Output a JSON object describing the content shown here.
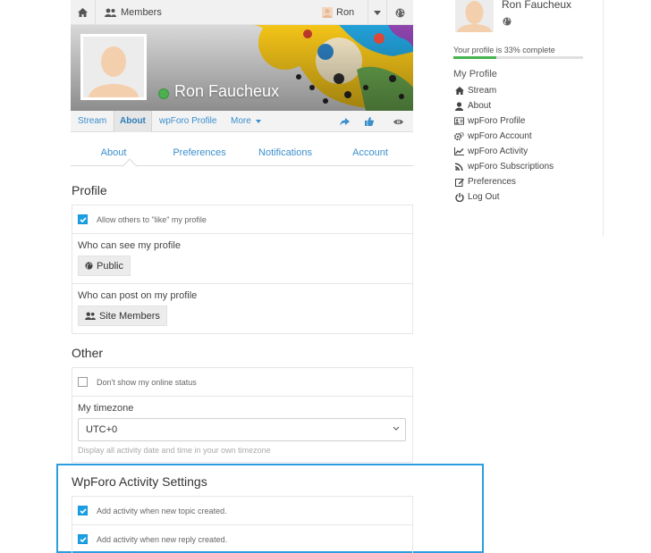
{
  "topbar": {
    "members_label": "Members",
    "user_label": "Ron"
  },
  "profile": {
    "display_name": "Ron Faucheux",
    "nav_tabs": [
      "Stream",
      "About",
      "wpForo Profile",
      "More"
    ]
  },
  "settings_tabs": [
    "About",
    "Preferences",
    "Notifications",
    "Account"
  ],
  "sections": {
    "profile_title": "Profile",
    "allow_like_label": "Allow others to \"like\" my profile",
    "who_see_label": "Who can see my profile",
    "who_see_value": "Public",
    "who_post_label": "Who can post on my profile",
    "who_post_value": "Site Members",
    "other_title": "Other",
    "online_status_label": "Don't show my online status",
    "timezone_label": "My timezone",
    "timezone_value": "UTC+0",
    "timezone_hint": "Display all activity date and time in your own timezone",
    "wpforo_title": "WpForo Activity Settings",
    "new_topic_label": "Add activity when new topic created.",
    "new_reply_label": "Add activity when new reply created."
  },
  "checkbox_states": {
    "allow_like": true,
    "online_status": false,
    "new_topic": true,
    "new_reply": true
  },
  "sidebar": {
    "name": "Ron Faucheux",
    "progress_text": "Your profile is 33% complete",
    "progress_value": 0.33,
    "menu_title": "My Profile",
    "items": [
      {
        "label": "Stream",
        "icon": "home-icon"
      },
      {
        "label": "About",
        "icon": "user-icon"
      },
      {
        "label": "wpForo Profile",
        "icon": "id-card-icon"
      },
      {
        "label": "wpForo Account",
        "icon": "cogs-icon"
      },
      {
        "label": "wpForo Activity",
        "icon": "line-chart-icon"
      },
      {
        "label": "wpForo Subscriptions",
        "icon": "rss-icon"
      },
      {
        "label": "Preferences",
        "icon": "edit-icon"
      },
      {
        "label": "Log Out",
        "icon": "power-icon"
      }
    ]
  },
  "colors": {
    "accent": "#3a8fcc",
    "checkbox": "#1aa0e6",
    "highlight_border": "#2b9de0",
    "online": "#4caf50",
    "progress": "#46b450"
  }
}
